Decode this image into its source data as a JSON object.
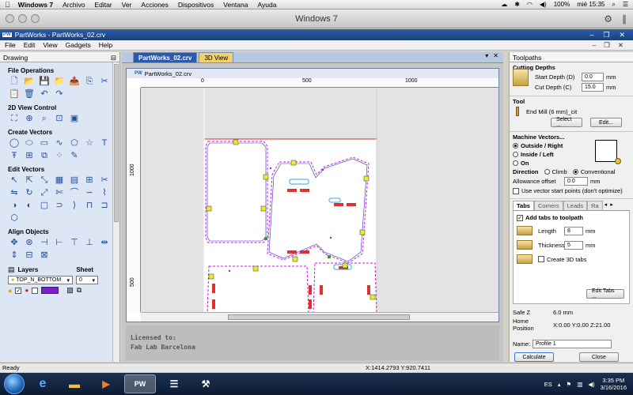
{
  "mac_menubar": {
    "app": "Windows 7",
    "menus": [
      "Archivo",
      "Editar",
      "Ver",
      "Acciones",
      "Dispositivos",
      "Ventana",
      "Ayuda"
    ],
    "battery": "100%",
    "clock": "mié 15:35"
  },
  "vm_window": {
    "title": "Windows 7"
  },
  "app": {
    "title": "PartWorks - PartWorks_02.crv",
    "logo": "PW",
    "menus": [
      "File",
      "Edit",
      "View",
      "Gadgets",
      "Help"
    ]
  },
  "left_panel": {
    "header": "Drawing",
    "sections": {
      "file_ops": "File Operations",
      "view_ctrl": "2D View Control",
      "create_vectors": "Create Vectors",
      "edit_vectors": "Edit Vectors",
      "align": "Align Objects",
      "layers": "Layers",
      "sheet": "Sheet"
    },
    "layer_value": "TOP_N_BOTTOM",
    "sheet_value": "0"
  },
  "center": {
    "tabs": [
      "PartWorks_02.crv",
      "3D View"
    ],
    "doc_title": "PartWorks_02.crv",
    "ruler_h": [
      "0",
      "500",
      "1000"
    ],
    "ruler_v": [
      "1000",
      "500"
    ],
    "license_line1": "Licensed to:",
    "license_line2": "Fab Lab Barcelona"
  },
  "right_panel": {
    "header": "Toolpaths",
    "cutting_depths": {
      "title": "Cutting Depths",
      "start_label": "Start Depth (D)",
      "start_value": "0.0",
      "cut_label": "Cut Depth (C)",
      "cut_value": "15.0",
      "unit": "mm"
    },
    "tool": {
      "title": "Tool",
      "name": "End Mill (6 mm)_cit",
      "select": "Select ...",
      "edit": "Edit..."
    },
    "machine_vectors": {
      "title": "Machine Vectors...",
      "options": [
        "Outside / Right",
        "Inside / Left",
        "On"
      ],
      "selected": 0
    },
    "direction": {
      "label": "Direction",
      "climb": "Climb",
      "conventional": "Conventional"
    },
    "allowance": {
      "label": "Allowance offset",
      "value": "0.0",
      "unit": "mm"
    },
    "vector_start": "Use vector start points (don't optimize)",
    "subtabs": [
      "Tabs",
      "Corners",
      "Leads",
      "Ra"
    ],
    "tabs_panel": {
      "add_tabs": "Add tabs to toolpath",
      "length_label": "Length",
      "length_value": "8",
      "thickness_label": "Thickness",
      "thickness_value": "5",
      "unit": "mm",
      "create_3d": "Create 3D tabs",
      "edit_tabs": "Edit Tabs ..."
    },
    "safe_z_label": "Safe Z",
    "safe_z_value": "6.0 mm",
    "home_label": "Home Position",
    "home_value": "X:0.00 Y:0.00 Z:21.00",
    "name_label": "Name:",
    "name_value": "Profile 1",
    "calculate": "Calculate",
    "close": "Close"
  },
  "status": {
    "text": "Ready",
    "coords": "X:1414.2793 Y:920.7411"
  },
  "taskbar": {
    "lang": "ES",
    "time": "3:35 PM",
    "date": "3/16/2016",
    "pw_label": "PW"
  }
}
